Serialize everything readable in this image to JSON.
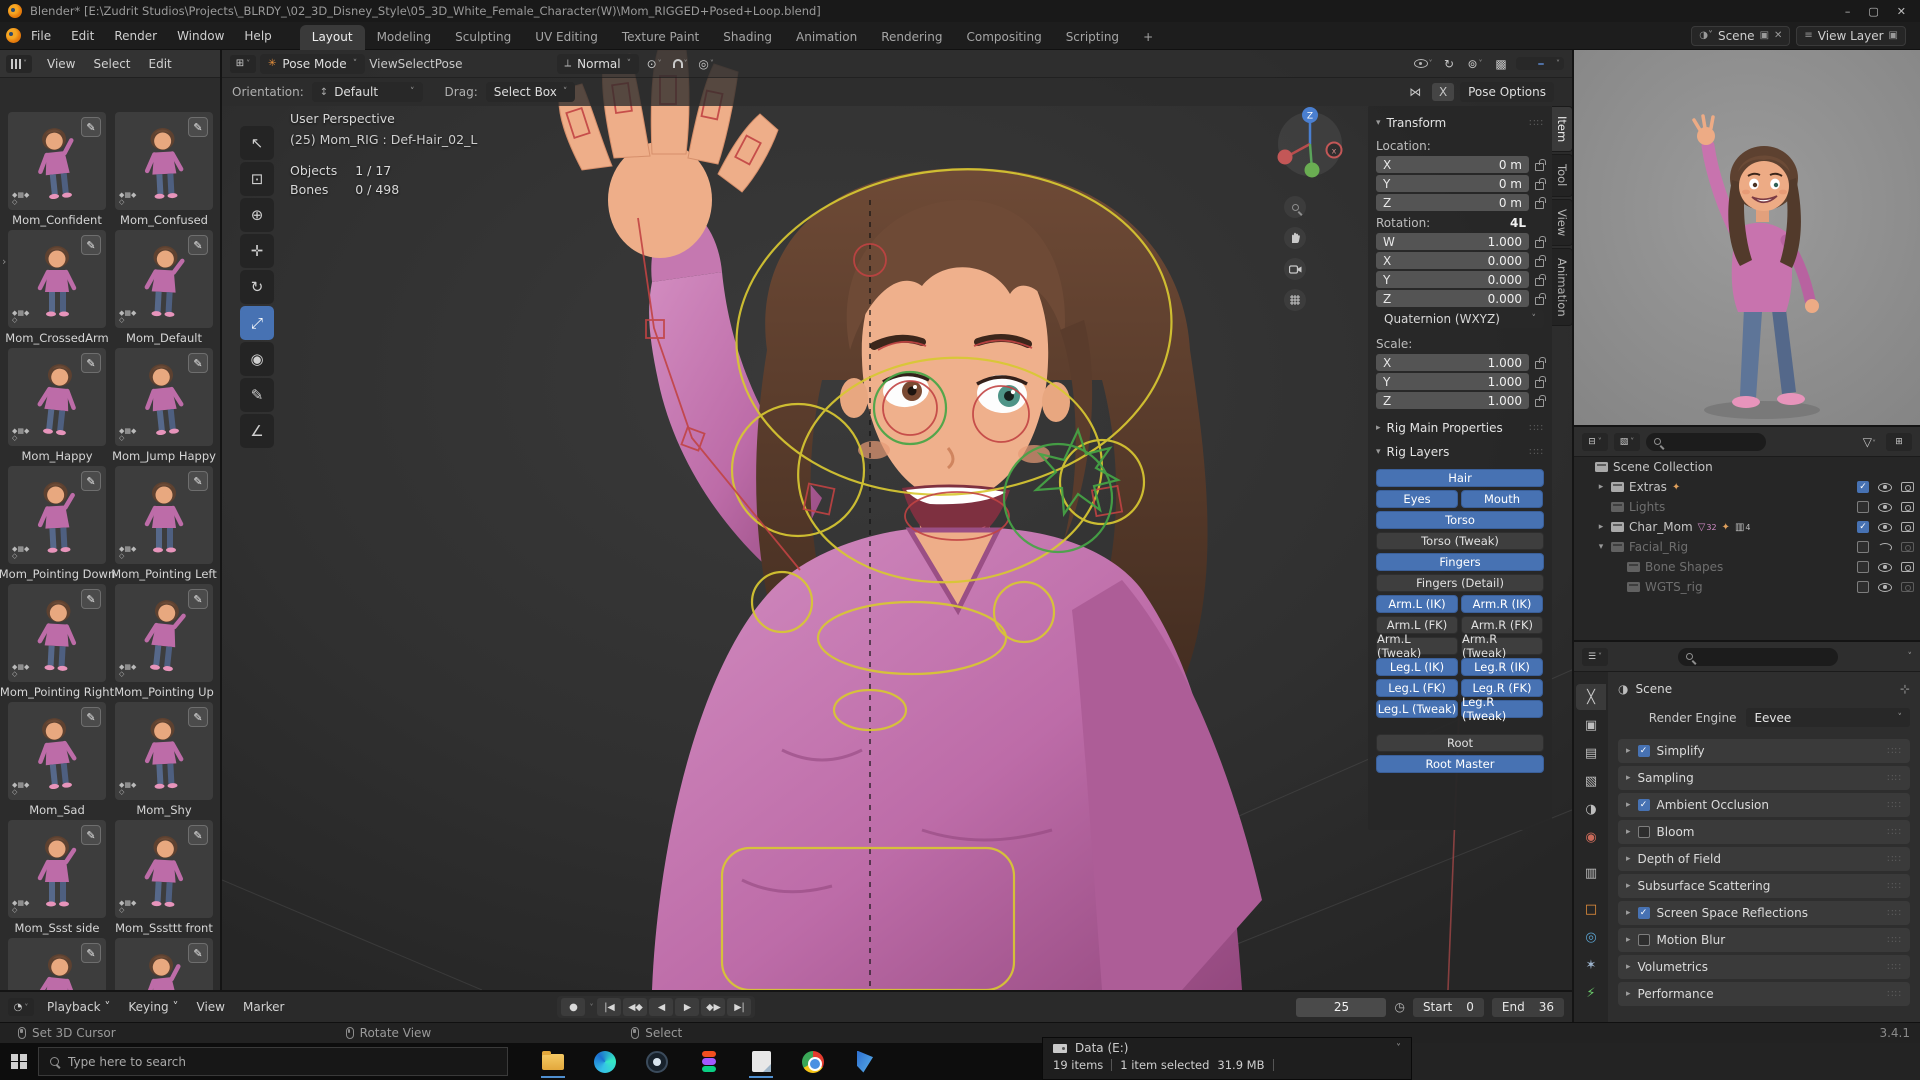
{
  "window": {
    "title": "Blender* [E:\\Zudrit Studios\\Projects\\_BLRDY_\\02_3D_Disney_Style\\05_3D_White_Female_Character(W)\\Mom_RIGGED+Posed+Loop.blend]",
    "controls": {
      "minimize": "–",
      "maximize": "▢",
      "close": "✕"
    }
  },
  "menubar": {
    "menus": [
      "File",
      "Edit",
      "Render",
      "Window",
      "Help"
    ],
    "tabs": [
      {
        "label": "Layout",
        "active": true
      },
      {
        "label": "Modeling"
      },
      {
        "label": "Sculpting"
      },
      {
        "label": "UV Editing"
      },
      {
        "label": "Texture Paint"
      },
      {
        "label": "Shading"
      },
      {
        "label": "Animation"
      },
      {
        "label": "Rendering"
      },
      {
        "label": "Compositing"
      },
      {
        "label": "Scripting"
      },
      {
        "label": "+"
      }
    ],
    "scene_label": "Scene",
    "view_layer_label": "View Layer"
  },
  "asset_browser": {
    "menus": [
      "View",
      "Select",
      "Edit"
    ],
    "assets": [
      "Mom_Confident",
      "Mom_Confused",
      "Mom_CrossedArm",
      "Mom_Default",
      "Mom_Happy",
      "Mom_Jump Happy",
      "Mom_Pointing Down",
      "Mom_Pointing Left",
      "Mom_Pointing Right",
      "Mom_Pointing Up",
      "Mom_Sad",
      "Mom_Shy",
      "Mom_Ssst side",
      "Mom_Sssttt front",
      "",
      ""
    ]
  },
  "viewport": {
    "mode": "Pose Mode",
    "menus": [
      "View",
      "Select",
      "Pose"
    ],
    "tool_settings": {
      "orientation_label": "Orientation:",
      "orientation_value": "Default",
      "drag_label": "Drag:",
      "drag_value": "Select Box",
      "mirror_x_label": "X",
      "options_label": "Pose Options"
    },
    "transform_orientation": "Normal",
    "info": {
      "perspective": "User Perspective",
      "active_item": "(25) Mom_RIG : Def-Hair_02_L",
      "objects_label": "Objects",
      "objects_value": "1 / 17",
      "bones_label": "Bones",
      "bones_value": "0 / 498"
    },
    "gizmo_axis_z": "Z",
    "tools": [
      {
        "name": "tweak",
        "glyph": "↖"
      },
      {
        "name": "select-box",
        "glyph": "⊡"
      },
      {
        "name": "cursor",
        "glyph": "⊕"
      },
      {
        "name": "move",
        "glyph": "✛"
      },
      {
        "name": "rotate",
        "glyph": "↻"
      },
      {
        "name": "scale",
        "glyph": "⤢",
        "active": true
      },
      {
        "name": "transform",
        "glyph": "◉"
      },
      {
        "name": "annotate",
        "glyph": "✎"
      },
      {
        "name": "measure",
        "glyph": "∠"
      }
    ]
  },
  "sidebar": {
    "tabs": [
      {
        "label": "Item",
        "active": true
      },
      {
        "label": "Tool"
      },
      {
        "label": "View"
      },
      {
        "label": "Animation"
      }
    ],
    "transform_title": "Transform",
    "location_label": "Location:",
    "location": [
      {
        "axis": "X",
        "value": "0 m"
      },
      {
        "axis": "Y",
        "value": "0 m"
      },
      {
        "axis": "Z",
        "value": "0 m"
      }
    ],
    "rotation_label": "Rotation:",
    "rotation_badge": "4L",
    "rotation": [
      {
        "axis": "W",
        "value": "1.000"
      },
      {
        "axis": "X",
        "value": "0.000"
      },
      {
        "axis": "Y",
        "value": "0.000"
      },
      {
        "axis": "Z",
        "value": "0.000"
      }
    ],
    "rotation_mode": "Quaternion (WXYZ)",
    "scale_label": "Scale:",
    "scale": [
      {
        "axis": "X",
        "value": "1.000"
      },
      {
        "axis": "Y",
        "value": "1.000"
      },
      {
        "axis": "Z",
        "value": "1.000"
      }
    ],
    "rig_main_properties": "Rig Main Properties",
    "rig_layers_title": "Rig Layers",
    "rig_buttons": [
      {
        "label": "Hair",
        "active": true,
        "full": true
      },
      {
        "label": "Eyes",
        "active": true
      },
      {
        "label": "Mouth",
        "active": true
      },
      {
        "label": "Torso",
        "active": true,
        "full": true
      },
      {
        "label": "Torso (Tweak)",
        "active": false,
        "full": true
      },
      {
        "label": "Fingers",
        "active": true,
        "full": true
      },
      {
        "label": "Fingers (Detail)",
        "active": false,
        "full": true
      },
      {
        "label": "Arm.L (IK)",
        "active": true
      },
      {
        "label": "Arm.R (IK)",
        "active": true
      },
      {
        "label": "Arm.L (FK)",
        "active": false
      },
      {
        "label": "Arm.R (FK)",
        "active": false
      },
      {
        "label": "Arm.L (Tweak)",
        "active": false
      },
      {
        "label": "Arm.R (Tweak)",
        "active": false
      },
      {
        "label": "Leg.L (IK)",
        "active": true
      },
      {
        "label": "Leg.R (IK)",
        "active": true
      },
      {
        "label": "Leg.L (FK)",
        "active": true
      },
      {
        "label": "Leg.R (FK)",
        "active": true
      },
      {
        "label": "Leg.L (Tweak)",
        "active": true
      },
      {
        "label": "Leg.R (Tweak)",
        "active": true
      },
      {
        "label": "Root",
        "active": false,
        "full": true,
        "gap_before": true
      },
      {
        "label": "Root Master",
        "active": true,
        "full": true
      }
    ]
  },
  "outliner": {
    "rows": [
      {
        "name": "Scene Collection",
        "level": 0
      },
      {
        "name": "Extras",
        "level": 1,
        "expand": "▸",
        "badges": [
          {
            "glyph": "✦",
            "color": "#e0a05c"
          }
        ],
        "checkbox": "on",
        "eye": "open",
        "camera": "on"
      },
      {
        "name": "Lights",
        "level": 1,
        "dim": true,
        "checkbox": "off",
        "eye": "open",
        "camera": "on"
      },
      {
        "name": "Char_Mom",
        "level": 1,
        "expand": "▸",
        "badges": [
          {
            "glyph": "▽",
            "color": "#cf8bc4",
            "count": "32"
          },
          {
            "glyph": "✦",
            "color": "#e0a05c"
          },
          {
            "glyph": "▥",
            "color": "#bcbcbc",
            "count": "4"
          }
        ],
        "checkbox": "on",
        "eye": "open",
        "camera": "on"
      },
      {
        "name": "Facial_Rig",
        "level": 1,
        "expand": "▾",
        "dim": true,
        "checkbox": "off",
        "eye": "closed",
        "camera": "dim"
      },
      {
        "name": "Bone Shapes",
        "level": 2,
        "dim": true,
        "checkbox": "off",
        "eye": "open",
        "camera": "on"
      },
      {
        "name": "WGTS_rig",
        "level": 2,
        "dim": true,
        "checkbox": "off",
        "eye": "open",
        "camera": "dim"
      }
    ]
  },
  "properties": {
    "breadcrumb": "Scene",
    "render_engine_label": "Render Engine",
    "render_engine_value": "Eevee",
    "tabs": [
      {
        "name": "tool",
        "glyph": "╳",
        "color": "#c9c9c9",
        "active": true
      },
      {
        "name": "render",
        "glyph": "▣",
        "color": "#bdbdbd"
      },
      {
        "name": "output",
        "glyph": "▤",
        "color": "#bdbdbd"
      },
      {
        "name": "view-layer",
        "glyph": "▧",
        "color": "#bdbdbd"
      },
      {
        "name": "scene",
        "glyph": "◑",
        "color": "#bdbdbd"
      },
      {
        "name": "world",
        "glyph": "◉",
        "color": "#c96a5a",
        "gap": true
      },
      {
        "name": "collection",
        "glyph": "▥",
        "color": "#bdbdbd",
        "gap": true
      },
      {
        "name": "object",
        "glyph": "□",
        "color": "#e8913c"
      },
      {
        "name": "physics",
        "glyph": "◎",
        "color": "#5ba3d0"
      },
      {
        "name": "constraints",
        "glyph": "✶",
        "color": "#9fb6d0"
      },
      {
        "name": "data",
        "glyph": "⚡",
        "color": "#6ac96a"
      }
    ],
    "panels": [
      {
        "label": "Simplify",
        "checkbox": true,
        "checked": true
      },
      {
        "label": "Sampling"
      },
      {
        "label": "Ambient Occlusion",
        "checkbox": true,
        "checked": true
      },
      {
        "label": "Bloom",
        "checkbox": true,
        "checked": false
      },
      {
        "label": "Depth of Field"
      },
      {
        "label": "Subsurface Scattering"
      },
      {
        "label": "Screen Space Reflections",
        "checkbox": true,
        "checked": true
      },
      {
        "label": "Motion Blur",
        "checkbox": true,
        "checked": false
      },
      {
        "label": "Volumetrics"
      },
      {
        "label": "Performance"
      }
    ]
  },
  "timeline": {
    "menus": [
      "Playback",
      "Keying",
      "View",
      "Marker"
    ],
    "transport": [
      "|◀",
      "◀◆",
      "◀",
      "▶",
      "◆▶",
      "▶|"
    ],
    "record_glyph": "●",
    "frame_current": "25",
    "start_label": "Start",
    "start_value": "0",
    "end_label": "End",
    "end_value": "36"
  },
  "statusbar": {
    "items": [
      "Set 3D Cursor",
      "Rotate View",
      "Select"
    ],
    "version": "3.4.1"
  },
  "taskbar": {
    "search_placeholder": "Type here to search",
    "icons": [
      {
        "name": "file-explorer",
        "running": true
      },
      {
        "name": "edge"
      },
      {
        "name": "obs"
      },
      {
        "name": "figma"
      },
      {
        "name": "notes",
        "running": true
      },
      {
        "name": "chrome"
      },
      {
        "name": "hidden-app"
      }
    ],
    "explorer": {
      "title": "Data (E:)",
      "items": "19 items",
      "selected": "1 item selected",
      "size": "31.9 MB"
    }
  }
}
